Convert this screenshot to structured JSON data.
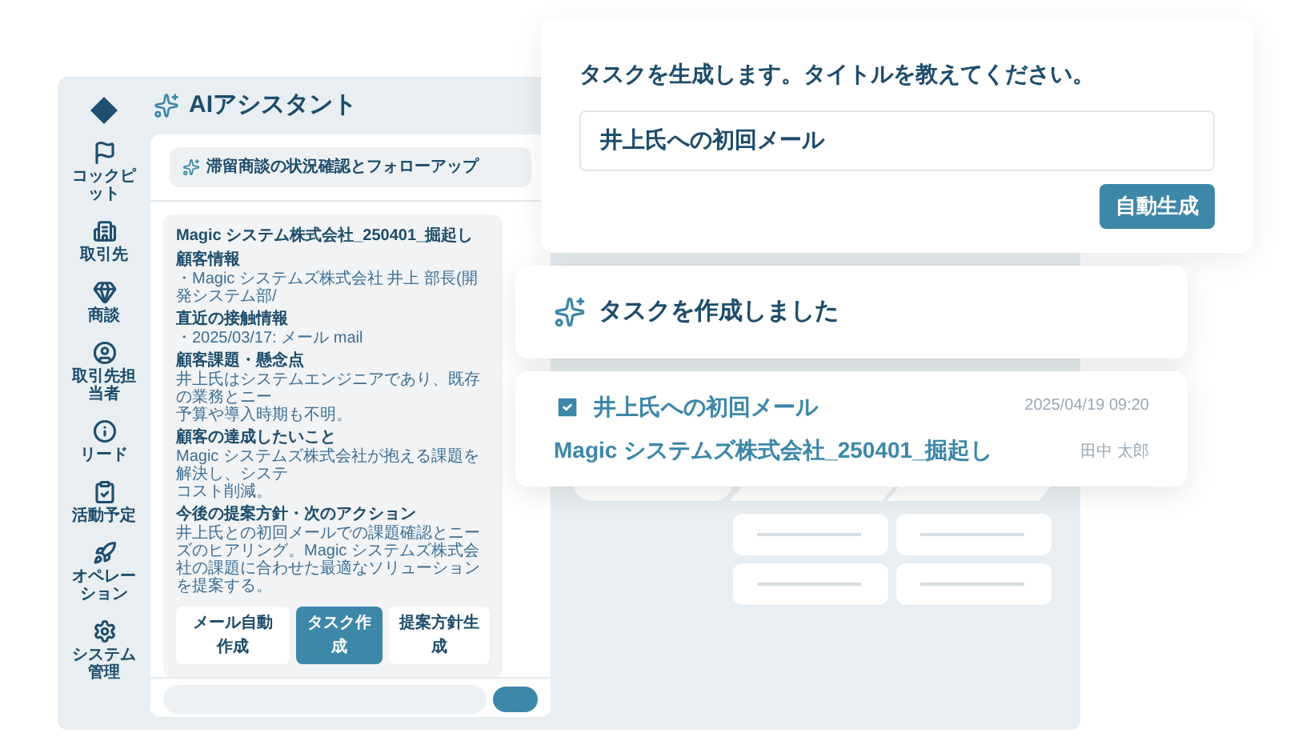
{
  "sidebar": {
    "items": [
      {
        "label": "コックピット"
      },
      {
        "label": "取引先"
      },
      {
        "label": "商談"
      },
      {
        "label": "取引先担当者"
      },
      {
        "label": "リード"
      },
      {
        "label": "活動予定"
      },
      {
        "label": "オペレーション"
      },
      {
        "label": "システム管理"
      }
    ]
  },
  "assistant": {
    "title": "AIアシスタント",
    "topic": "滞留商談の状況確認とフォローアップ",
    "summary": {
      "title": "Magic システム株式会社_250401_掘起し",
      "sections": [
        {
          "heading": "顧客情報",
          "lines": [
            "・Magic システムズ株式会社 井上 部長(開発システム部/"
          ]
        },
        {
          "heading": "直近の接触情報",
          "lines": [
            "・2025/03/17: メール mail"
          ]
        },
        {
          "heading": "顧客課題・懸念点",
          "lines": [
            "井上氏はシステムエンジニアであり、既存の業務とニー",
            "予算や導入時期も不明。"
          ]
        },
        {
          "heading": "顧客の達成したいこと",
          "lines": [
            "Magic システムズ株式会社が抱える課題を解決し、システ",
            "コスト削減。"
          ]
        },
        {
          "heading": "今後の提案方針・次のアクション",
          "lines": [
            "井上氏との初回メールでの課題確認とニーズのヒアリング。Magic システムズ株式会社の課題に合わせた最適なソリューションを提案する。"
          ]
        }
      ],
      "actions": [
        {
          "label": "メール自動作成",
          "selected": false
        },
        {
          "label": "タスク作成",
          "selected": true
        },
        {
          "label": "提案方針生成",
          "selected": false
        }
      ]
    }
  },
  "prompt_card": {
    "question": "タスクを生成します。タイトルを教えてください。",
    "value": "井上氏への初回メール",
    "button": "自動生成"
  },
  "notice": {
    "text": "タスクを作成しました"
  },
  "task": {
    "title": "井上氏への初回メール",
    "company": "Magic システムズ株式会社_250401_掘起し",
    "datetime": "2025/04/19 09:20",
    "assignee": "田中 太郎"
  }
}
